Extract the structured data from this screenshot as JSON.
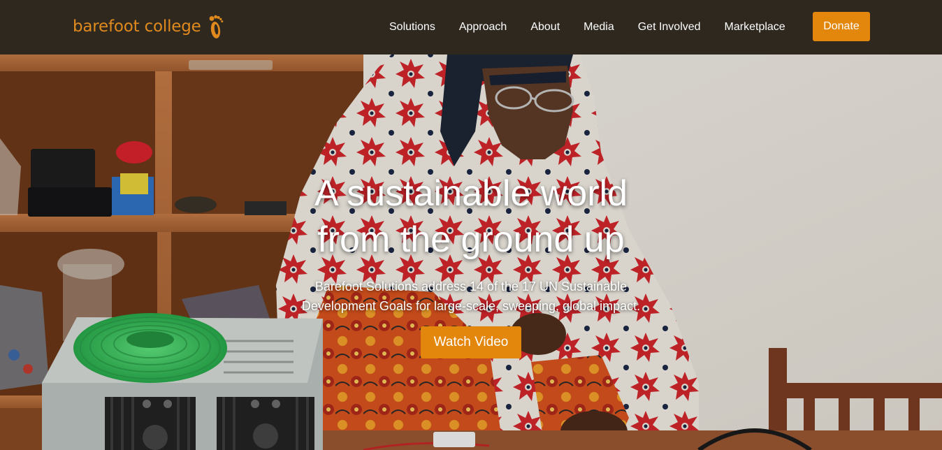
{
  "header": {
    "logo_text": "barefoot college",
    "logo_icon": "footprint-icon",
    "nav": [
      {
        "label": "Solutions"
      },
      {
        "label": "Approach"
      },
      {
        "label": "About"
      },
      {
        "label": "Media"
      },
      {
        "label": "Get Involved"
      },
      {
        "label": "Marketplace"
      }
    ],
    "donate_label": "Donate"
  },
  "hero": {
    "title_line1": "A sustainable world",
    "title_line2": "from the ground up",
    "subtitle_line1": "Barefoot Solutions address 14 of the 17 UN Sustainable",
    "subtitle_line2": "Development Goals for large-scale, sweeping, global impact.",
    "cta_label": "Watch Video",
    "background": "photo-woman-assembling-electronics"
  },
  "colors": {
    "header_bg": "#2e281f",
    "accent": "#e3860c",
    "logo": "#e08a1e",
    "text": "#ffffff"
  }
}
